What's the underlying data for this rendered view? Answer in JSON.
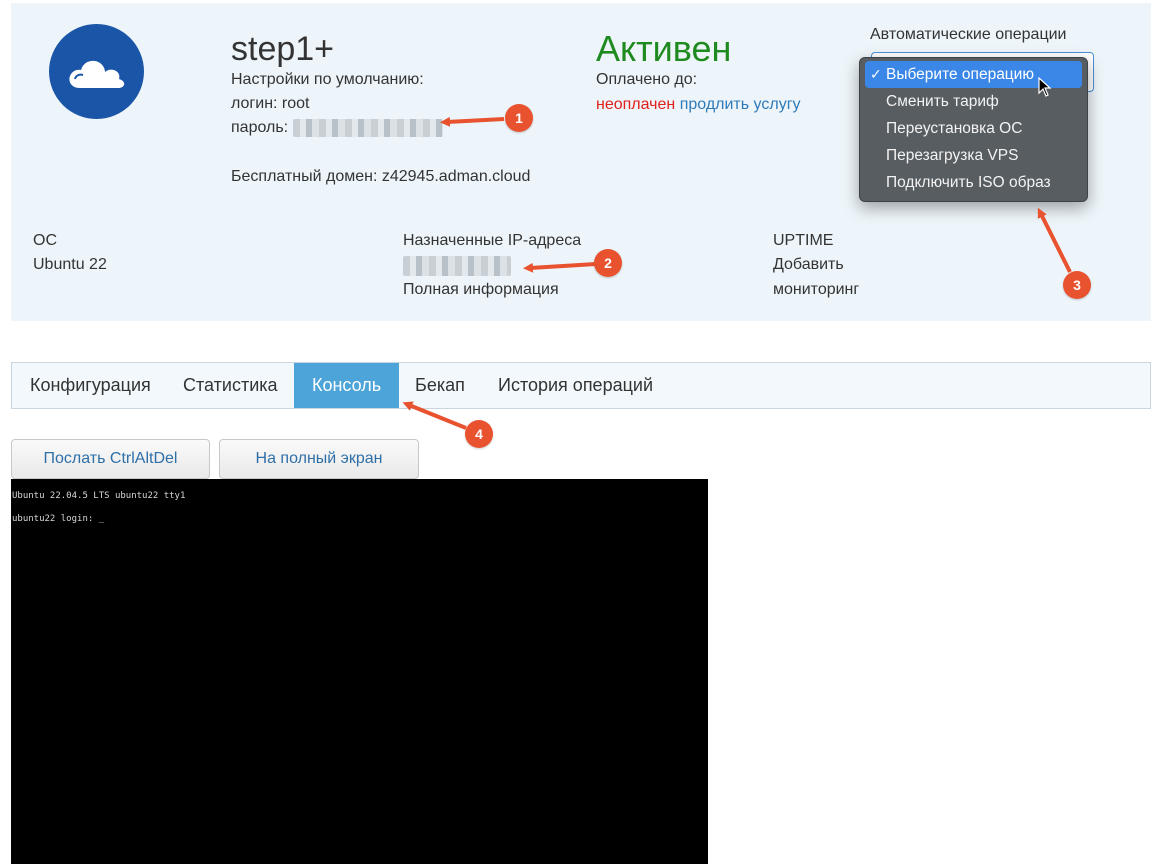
{
  "header": {
    "plan_name": "step1+",
    "defaults_label": "Настройки по умолчанию:",
    "login_line": "логин: root",
    "password_label": "пароль:",
    "free_domain": "Бесплатный домен: z42945.adman.cloud"
  },
  "status": {
    "state": "Активен",
    "paid_until_label": "Оплачено до:",
    "unpaid": "неоплачен",
    "extend_link": "продлить услугу"
  },
  "operations": {
    "label": "Автоматические операции",
    "items": [
      {
        "label": "Выберите операцию",
        "selected": true
      },
      {
        "label": "Сменить тариф",
        "selected": false
      },
      {
        "label": "Переустановка ОС",
        "selected": false
      },
      {
        "label": "Перезагрузка VPS",
        "selected": false
      },
      {
        "label": "Подключить ISO образ",
        "selected": false
      }
    ],
    "check_mark": "✓"
  },
  "os": {
    "label": "ОС",
    "value": "Ubuntu 22"
  },
  "ip": {
    "label": "Назначенные IP-адреса",
    "details_link": "Полная информация"
  },
  "uptime": {
    "label": "UPTIME",
    "link_line1": "Добавить",
    "link_line2": "мониторинг"
  },
  "tabs": [
    {
      "label": "Конфигурация",
      "active": false
    },
    {
      "label": "Статистика",
      "active": false
    },
    {
      "label": "Консоль",
      "active": true
    },
    {
      "label": "Бекап",
      "active": false
    },
    {
      "label": "История операций",
      "active": false
    }
  ],
  "buttons": {
    "ctrl_alt_del": "Послать CtrlAltDel",
    "fullscreen": "На полный экран"
  },
  "console": {
    "line1": "Ubuntu 22.04.5 LTS ubuntu22 tty1",
    "line2": "ubuntu22 login: _"
  },
  "annotations": [
    "1",
    "2",
    "3",
    "4"
  ],
  "colors": {
    "active_status": "#1f8a1f",
    "unpaid": "#e0201a",
    "link": "#2f7ab8",
    "active_tab": "#4ca4d8",
    "annotation": "#e8522f",
    "avatar": "#1a55a8"
  },
  "icons": {
    "avatar": "cloud-icon",
    "cursor": "mouse-pointer-icon"
  }
}
